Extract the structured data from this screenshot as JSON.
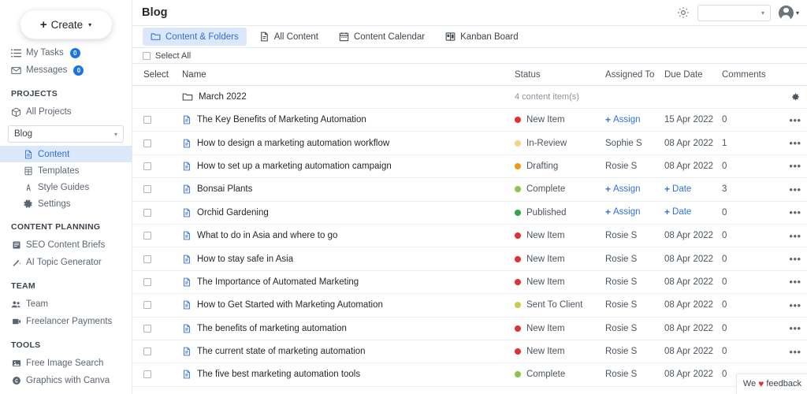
{
  "sidebar": {
    "create_button": {
      "label": "Create",
      "plus": "+",
      "caret": "▾"
    },
    "quick_links": [
      {
        "label": "My Tasks",
        "icon": "tasks-list-icon",
        "badge": "0"
      },
      {
        "label": "Messages",
        "icon": "envelope-icon",
        "badge": "0"
      }
    ],
    "sections": [
      {
        "title": "PROJECTS",
        "items": [
          {
            "label": "All Projects",
            "icon": "cube-icon"
          }
        ],
        "select": {
          "value": "Blog",
          "caret": "▾"
        },
        "sub_items": [
          {
            "label": "Content",
            "icon": "document-icon",
            "active": true
          },
          {
            "label": "Templates",
            "icon": "template-icon",
            "active": false
          },
          {
            "label": "Style Guides",
            "icon": "style-guide-icon",
            "active": false
          },
          {
            "label": "Settings",
            "icon": "gear-icon",
            "active": false
          }
        ]
      },
      {
        "title": "CONTENT PLANNING",
        "items": [
          {
            "label": "SEO Content Briefs",
            "icon": "briefs-icon"
          },
          {
            "label": "AI Topic Generator",
            "icon": "magic-wand-icon"
          }
        ]
      },
      {
        "title": "TEAM",
        "items": [
          {
            "label": "Team",
            "icon": "people-icon"
          },
          {
            "label": "Freelancer Payments",
            "icon": "payments-icon"
          }
        ]
      },
      {
        "title": "TOOLS",
        "items": [
          {
            "label": "Free Image Search",
            "icon": "image-icon"
          },
          {
            "label": "Graphics with Canva",
            "icon": "canva-icon"
          }
        ]
      }
    ]
  },
  "topbar": {
    "title": "Blog",
    "gear_icon": "gear-icon",
    "workspace_select": {
      "value": "",
      "caret": "▾"
    },
    "avatar_caret": "▾"
  },
  "tabs": [
    {
      "label": "Content & Folders",
      "icon": "folder-icon",
      "active": true
    },
    {
      "label": "All Content",
      "icon": "document-icon",
      "active": false
    },
    {
      "label": "Content Calendar",
      "icon": "calendar-icon",
      "active": false
    },
    {
      "label": "Kanban Board",
      "icon": "kanban-icon",
      "active": false
    }
  ],
  "select_all": {
    "label": "Select All",
    "checked": false
  },
  "table": {
    "columns": [
      "Select",
      "Name",
      "Status",
      "Assigned To",
      "Due Date",
      "Comments"
    ],
    "folder_row": {
      "name": "March 2022",
      "icon": "folder-icon",
      "meta": "4 content item(s)",
      "gear_icon": "gear-icon"
    },
    "rows": [
      {
        "name": "The Key Benefits of Marketing Automation",
        "status": "New Item",
        "status_color": "#e03131",
        "assigned": "Assign",
        "assigned_link": true,
        "due": "15 Apr 2022",
        "due_link": false,
        "comments": "0"
      },
      {
        "name": "How to design a marketing automation workflow",
        "status": "In-Review",
        "status_color": "#f7d08a",
        "assigned": "Sophie S",
        "assigned_link": false,
        "due": "08 Apr 2022",
        "due_link": false,
        "comments": "1"
      },
      {
        "name": "How to set up a marketing automation campaign",
        "status": "Drafting",
        "status_color": "#ee9a10",
        "assigned": "Rosie S",
        "assigned_link": false,
        "due": "08 Apr 2022",
        "due_link": false,
        "comments": "0"
      },
      {
        "name": "Bonsai Plants",
        "status": "Complete",
        "status_color": "#8ac44a",
        "assigned": "Assign",
        "assigned_link": true,
        "due": "Date",
        "due_link": true,
        "comments": "3"
      },
      {
        "name": "Orchid Gardening",
        "status": "Published",
        "status_color": "#2fa84a",
        "assigned": "Assign",
        "assigned_link": true,
        "due": "Date",
        "due_link": true,
        "comments": "0"
      },
      {
        "name": "What to do in Asia and where to go",
        "status": "New Item",
        "status_color": "#e03131",
        "assigned": "Rosie S",
        "assigned_link": false,
        "due": "08 Apr 2022",
        "due_link": false,
        "comments": "0"
      },
      {
        "name": "How to stay safe in Asia",
        "status": "New Item",
        "status_color": "#e03131",
        "assigned": "Rosie S",
        "assigned_link": false,
        "due": "08 Apr 2022",
        "due_link": false,
        "comments": "0"
      },
      {
        "name": "The Importance of Automated Marketing",
        "status": "New Item",
        "status_color": "#e03131",
        "assigned": "Rosie S",
        "assigned_link": false,
        "due": "08 Apr 2022",
        "due_link": false,
        "comments": "0"
      },
      {
        "name": "How to Get Started with Marketing Automation",
        "status": "Sent To Client",
        "status_color": "#ccca4e",
        "assigned": "Rosie S",
        "assigned_link": false,
        "due": "08 Apr 2022",
        "due_link": false,
        "comments": "0"
      },
      {
        "name": "The benefits of marketing automation",
        "status": "New Item",
        "status_color": "#e03131",
        "assigned": "Rosie S",
        "assigned_link": false,
        "due": "08 Apr 2022",
        "due_link": false,
        "comments": "0"
      },
      {
        "name": "The current state of marketing automation",
        "status": "New Item",
        "status_color": "#e03131",
        "assigned": "Rosie S",
        "assigned_link": false,
        "due": "08 Apr 2022",
        "due_link": false,
        "comments": "0"
      },
      {
        "name": "The five best marketing automation tools",
        "status": "Complete",
        "status_color": "#8ac44a",
        "assigned": "Rosie S",
        "assigned_link": false,
        "due": "08 Apr 2022",
        "due_link": false,
        "comments": "0"
      }
    ],
    "row_actions_label": "•••"
  },
  "feedback_widget": {
    "prefix": "We",
    "heart": "♥",
    "suffix": "feedback"
  },
  "colors": {
    "accent": "#3272d9",
    "tab_active_bg": "#dbe8fb",
    "badge": "#1a73e8"
  }
}
